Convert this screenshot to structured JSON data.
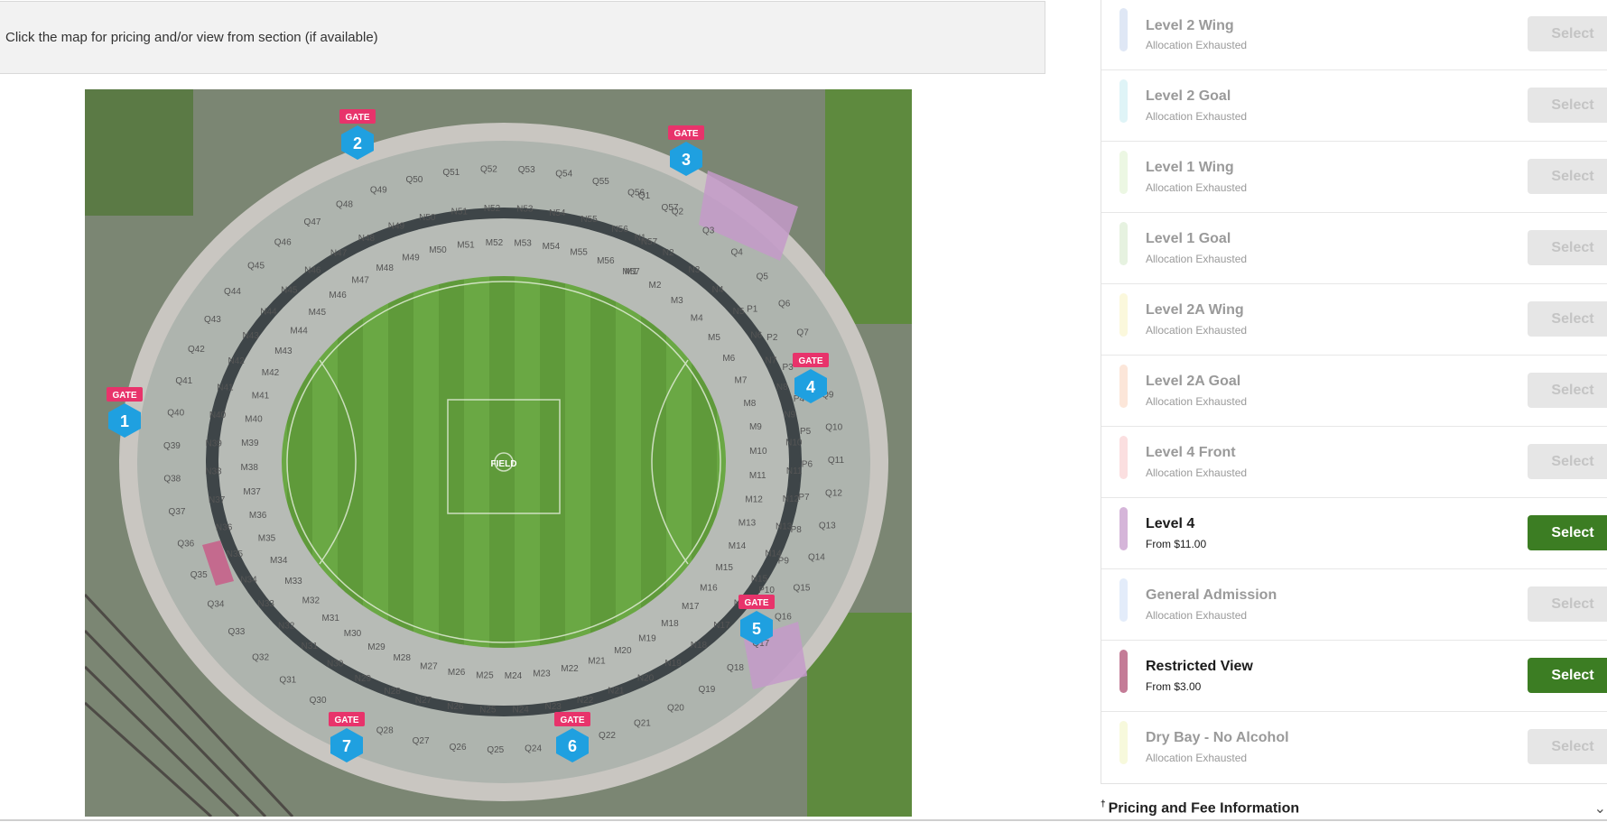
{
  "header": {
    "instruction": "Click the map for pricing and/or view from section (if available)"
  },
  "map": {
    "field_label": "FIELD",
    "gates": [
      {
        "label": "GATE",
        "number": "1"
      },
      {
        "label": "GATE",
        "number": "2"
      },
      {
        "label": "GATE",
        "number": "3"
      },
      {
        "label": "GATE",
        "number": "4"
      },
      {
        "label": "GATE",
        "number": "5"
      },
      {
        "label": "GATE",
        "number": "6"
      },
      {
        "label": "GATE",
        "number": "7"
      }
    ],
    "section_prefixes": [
      "Q",
      "N",
      "M",
      "P"
    ],
    "colors": {
      "gate": "#e8336b",
      "gate_number": "#1fa0e0",
      "highlight_level4": "#c49ac9",
      "highlight_restricted": "#c46a8e"
    }
  },
  "categories": [
    {
      "name": "Level 2 Wing",
      "status": "Allocation Exhausted",
      "available": false,
      "color": "#dfe7f5",
      "button": "Select"
    },
    {
      "name": "Level 2 Goal",
      "status": "Allocation Exhausted",
      "available": false,
      "color": "#dff4f7",
      "button": "Select"
    },
    {
      "name": "Level 1 Wing",
      "status": "Allocation Exhausted",
      "available": false,
      "color": "#ecf7e3",
      "button": "Select"
    },
    {
      "name": "Level 1 Goal",
      "status": "Allocation Exhausted",
      "available": false,
      "color": "#e6f2e0",
      "button": "Select"
    },
    {
      "name": "Level 2A Wing",
      "status": "Allocation Exhausted",
      "available": false,
      "color": "#fbf8dc",
      "button": "Select"
    },
    {
      "name": "Level 2A Goal",
      "status": "Allocation Exhausted",
      "available": false,
      "color": "#fce6d9",
      "button": "Select"
    },
    {
      "name": "Level 4 Front",
      "status": "Allocation Exhausted",
      "available": false,
      "color": "#fbdfe0",
      "button": "Select"
    },
    {
      "name": "Level 4",
      "status": "From $11.00",
      "available": true,
      "color": "#d5b5d9",
      "button": "Select"
    },
    {
      "name": "General Admission",
      "status": "Allocation Exhausted",
      "available": false,
      "color": "#e3ecfa",
      "button": "Select"
    },
    {
      "name": "Restricted View",
      "status": "From $3.00",
      "available": true,
      "color": "#c47c97",
      "button": "Select"
    },
    {
      "name": "Dry Bay - No Alcohol",
      "status": "Allocation Exhausted",
      "available": false,
      "color": "#f7f9dc",
      "button": "Select"
    }
  ],
  "pricing": {
    "dagger": "†",
    "label": "Pricing and Fee Information",
    "chevron": "chevron-down-icon"
  }
}
